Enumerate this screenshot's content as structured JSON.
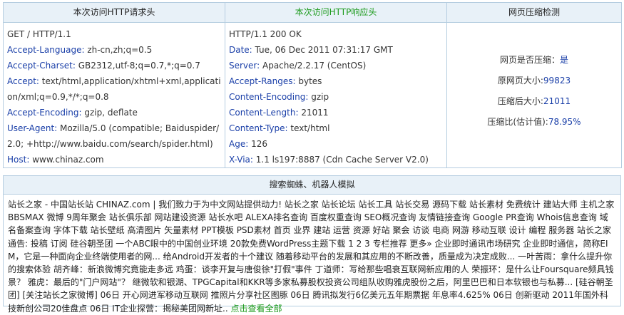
{
  "headers": {
    "request": "本次访问HTTP请求头",
    "response": "本次访问HTTP响应头",
    "compression": "网页压缩检测"
  },
  "request": {
    "first_line": "GET / HTTP/1.1",
    "fields": [
      {
        "key": "Accept-Language:",
        "value": " zh-cn,zh;q=0.5"
      },
      {
        "key": "Accept-Charset:",
        "value": " GB2312,utf-8;q=0.7,*;q=0.7"
      },
      {
        "key": "Accept:",
        "value": " text/html,application/xhtml+xml,application/xml;q=0.9,*/*;q=0.8"
      },
      {
        "key": "Accept-Encoding:",
        "value": " gzip, deflate"
      },
      {
        "key": "User-Agent:",
        "value": " Mozilla/5.0 (compatible; Baiduspider/2.0; +http://www.baidu.com/search/spider.html)"
      },
      {
        "key": "Host:",
        "value": " www.chinaz.com"
      }
    ]
  },
  "response": {
    "first_line": "HTTP/1.1 200 OK",
    "fields": [
      {
        "key": "Date:",
        "value": " Tue, 06 Dec 2011 07:31:17 GMT"
      },
      {
        "key": "Server:",
        "value": " Apache/2.2.17 (CentOS)"
      },
      {
        "key": "Accept-Ranges:",
        "value": " bytes"
      },
      {
        "key": "Content-Encoding:",
        "value": " gzip"
      },
      {
        "key": "Content-Length:",
        "value": " 21011"
      },
      {
        "key": "Content-Type:",
        "value": " text/html"
      },
      {
        "key": "Age:",
        "value": " 126"
      },
      {
        "key": "X-Via:",
        "value": " 1.1 ls197:8887 (Cdn Cache Server V2.0)"
      }
    ]
  },
  "compression": {
    "is_compressed_label": "网页是否压缩：",
    "is_compressed_value": "是",
    "original_size_label": "原网页大小:",
    "original_size_value": "99823",
    "compressed_size_label": "压缩后大小:",
    "compressed_size_value": "21011",
    "ratio_label": "压缩比(估计值):",
    "ratio_value": "78.95%"
  },
  "spider": {
    "title": "搜索蜘蛛、机器人模拟",
    "text": "站长之家 - 中国站长站 CHINAZ.com | 我们致力于为中文网站提供动力! 站长之家 站长论坛 站长工具 站长交易 源码下载 站长素材 免费统计 建站大师 主机之家 BBSMAX 微博 9周年聚会 站长俱乐部 网站建设资源 站长水吧 ALEXA排名查询 百度权重查询 SEO概况查询 友情链接查询 Google PR查询 Whois信息查询 域名备案查询 字体下载 站长壁纸 高清图片 矢量素材 PPT模板 PSD素材 首页 业界 建站 运营 资源 好站 聚会 访谈 电商 网游 移动互联 设计 编程 服务器 站长之家通告: 投稿 订阅 硅谷朝圣团 一个ABC眼中的中国创业环境 20款免费WordPress主题下载 1 2 3 专栏推荐 更多» 企业即时通讯市场研究 企业即时通信，简称EIM，它是一种面向企业终端使用者的网... 给Android开发者的十个建议 随着移动平台的发展和其应用的不断改善，质量成为决定成败... 一叶苦雨：拿什么提升你的搜索体验 胡齐峰：新浪微博究竟能走多远 鸡蛋：谈李开复与唐俊徐\"打假\"事件 丁道师：写给那些唱衰互联网新应用的人 荣振环：是什么让Foursquare频具钱景？ 雅虎：最后的\"门户网站\"？ 继微软和银湖、TPGCapital和KKR等多家私募股权投资公司组队收购雅虎股份之后，阿里巴巴和日本软银也与私募... [硅谷朝圣团] [关注站长之家微博] 06日 开心网进军移动互联网 推照片分享社区图豚 06日 腾讯拟发行6亿美元五年期票据 年息率4.625% 06日 创新驱动 2011年国外科技新创公司20佳盘点 06日 IT企业探营：揭秘美团网新址.. ",
    "link": "点击查看全部"
  }
}
